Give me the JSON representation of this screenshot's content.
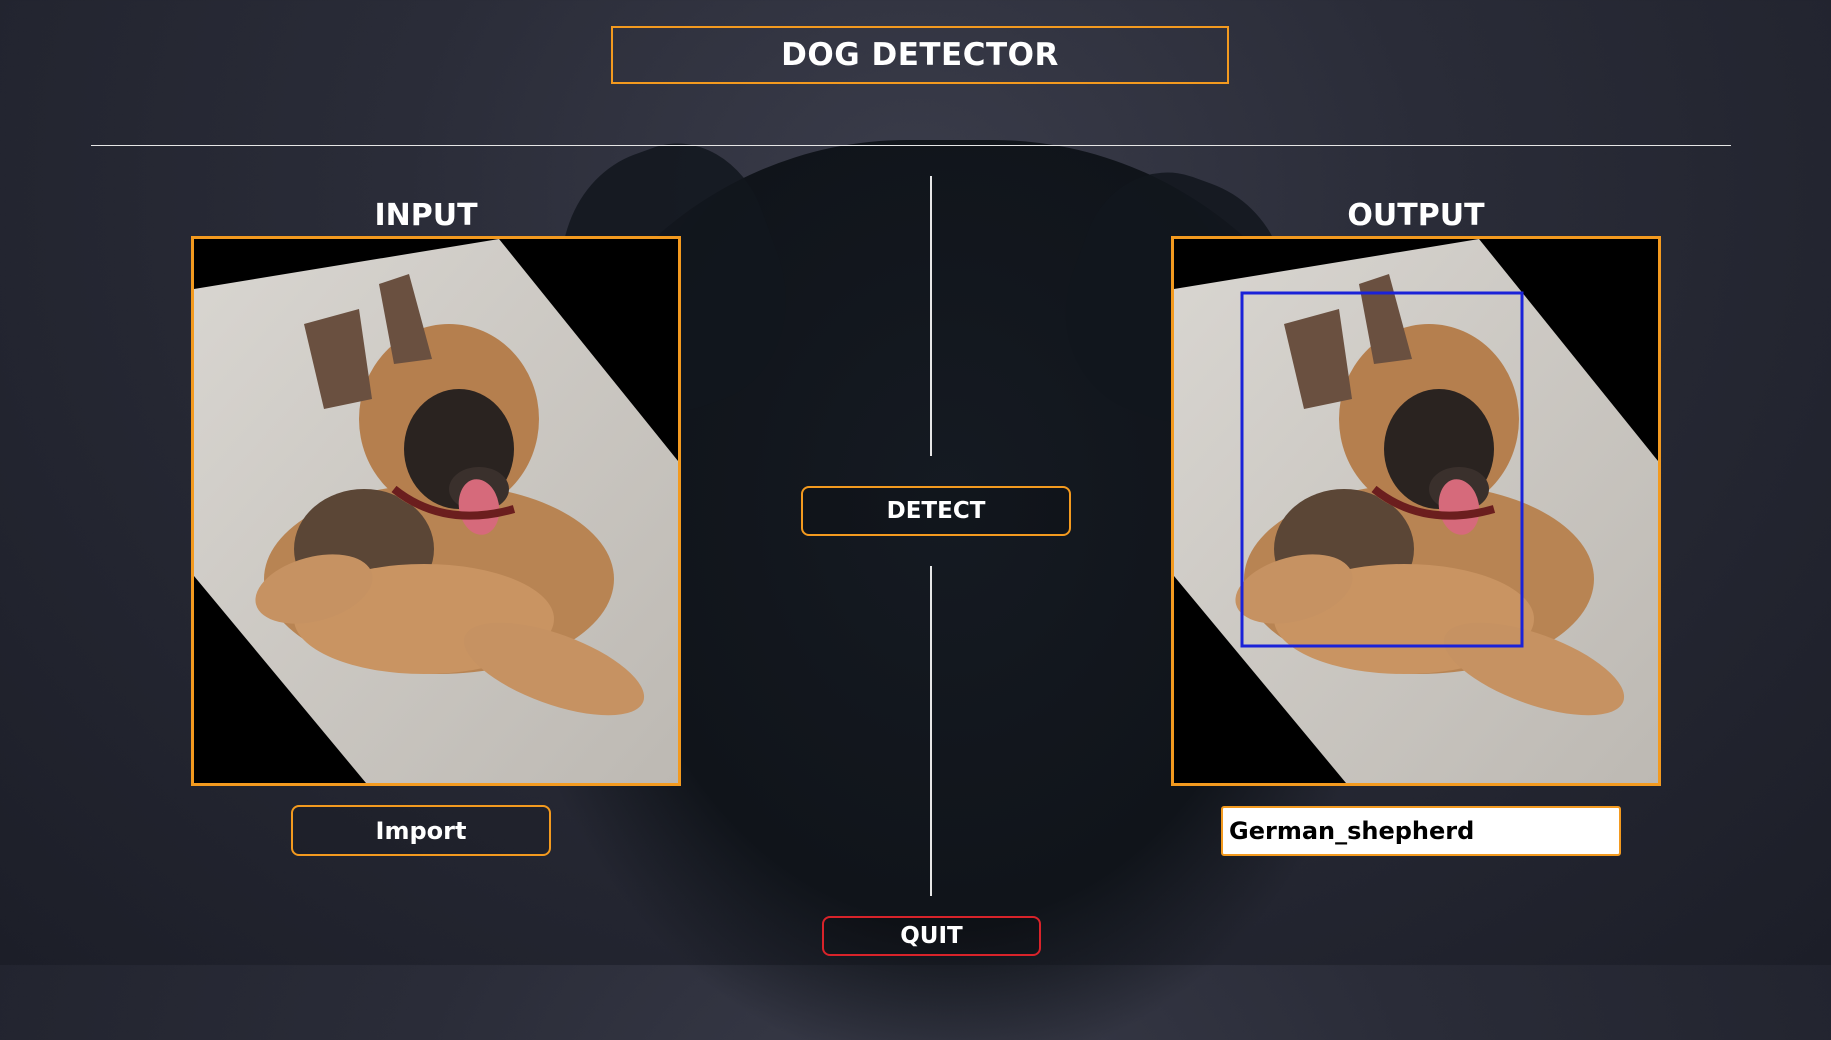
{
  "app": {
    "title": "DOG DETECTOR"
  },
  "input_section": {
    "title": "INPUT"
  },
  "output_section": {
    "title": "OUTPUT"
  },
  "buttons": {
    "detect": "DETECT",
    "import": "Import",
    "quit": "QUIT"
  },
  "result": {
    "value": "German_shepherd"
  },
  "colors": {
    "accent": "#f39a1f",
    "quit_border": "#d8232a",
    "bbox": "#1a22d8"
  }
}
